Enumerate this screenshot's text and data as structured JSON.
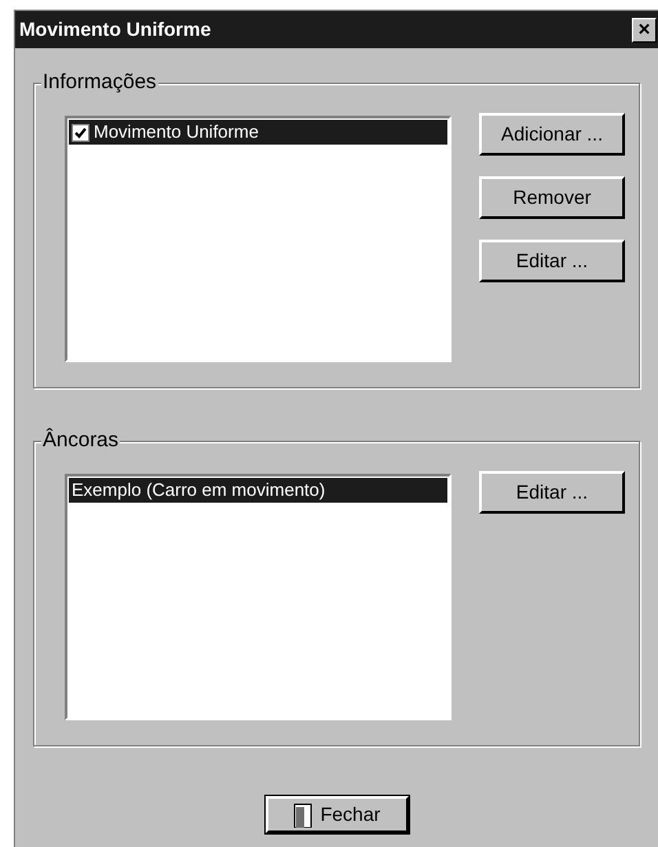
{
  "window": {
    "title": "Movimento Uniforme",
    "close": "×"
  },
  "groups": [
    {
      "legend": "Informações",
      "items": [
        {
          "label": "Movimento Uniforme",
          "kind": "checkbox",
          "checked": true,
          "selected": true
        }
      ],
      "buttons": [
        "Adicionar ...",
        "Remover",
        "Editar ..."
      ]
    },
    {
      "legend": "Âncoras",
      "items": [
        {
          "label": "Exemplo (Carro em movimento)",
          "kind": "plain",
          "selected": true
        }
      ],
      "buttons": [
        "Editar ..."
      ]
    }
  ],
  "footer_button": "Fechar"
}
